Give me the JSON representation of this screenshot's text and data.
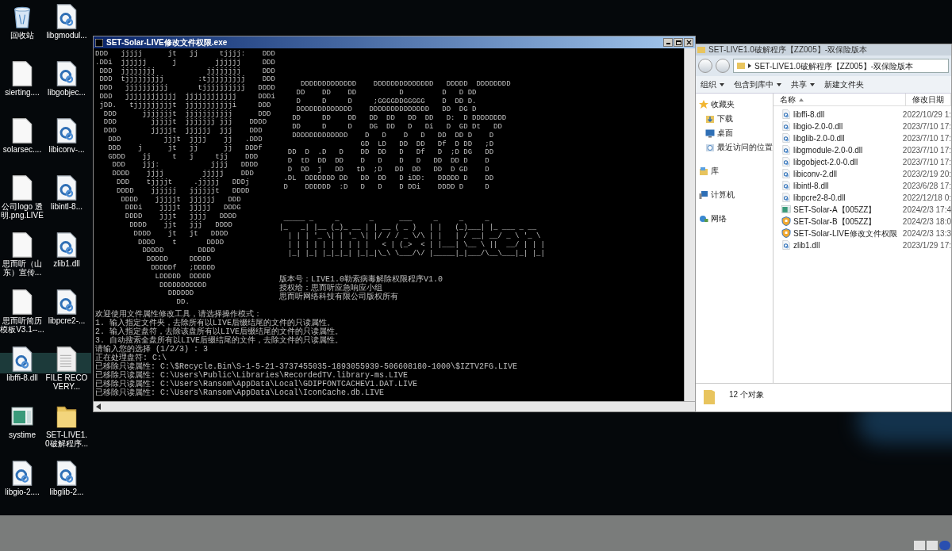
{
  "desktop_icons": [
    {
      "label": "回收站",
      "kind": "recycle"
    },
    {
      "label": "libgmodul...",
      "kind": "dll"
    },
    {
      "label": "sierting....",
      "kind": "blank"
    },
    {
      "label": "libgobjec...",
      "kind": "dll"
    },
    {
      "label": "solarsec....",
      "kind": "blank"
    },
    {
      "label": "libiconv-...",
      "kind": "dll"
    },
    {
      "label": "公司logo 透明.png.LIVE",
      "kind": "blank"
    },
    {
      "label": "libintl-8...",
      "kind": "dll"
    },
    {
      "label": "思而听（山东）宣传...",
      "kind": "blank"
    },
    {
      "label": "zlib1.dll",
      "kind": "dll"
    },
    {
      "label": "思而听简历模板V3.1--...",
      "kind": "blank"
    },
    {
      "label": "libpcre2-...",
      "kind": "dll"
    },
    {
      "label": "libffi-8.dll",
      "kind": "dll"
    },
    {
      "label": "FILE RECOVERY...",
      "kind": "text"
    },
    {
      "label": "systime",
      "kind": "app"
    },
    {
      "label": "SET-LIVE1.0破解程序...",
      "kind": "folder"
    },
    {
      "label": "libgio-2....",
      "kind": "dll"
    },
    {
      "label": "libglib-2...",
      "kind": "dll"
    }
  ],
  "console": {
    "title": "SET-Solar-LIVE修改文件权限.exe",
    "art_left": [
      "DDD   jjjjj      jt   jj     tjjjj:    DDD",
      ".DDi  jjjjjj      j         jjjjjj     DDD",
      " DDD  jjjjjjjj            jjjjjjjj     DDD",
      " DDD  tjjjjjjjjj        :tjjjjjjjjj    DDD",
      " DDD   jjjjjjjjjj       tjjjjjjjjjj   DDDD",
      " DDD   jjjjjjjjjjjj  jjjjjjjjjjjj     DDDi",
      " jDD.   tjjjjjjjjjt  jjjjjjjjjjji     DDD",
      "  DDD      jjjjjjjt  jjjjjjjjjjj      DDD",
      "  DDD        jjjjjt  jjjjjjj jjj    DDDD",
      "  DDD        jjjjjt  jjjjjj  jjj    DDD",
      "   DDD          jjjt  jjjj    jj   .DDD",
      "   DDD    j      jt   jj      jj   DDDf",
      "   GDDD    jj     t   j     tjj    DDD",
      "    DDD    jjj:            jjjj   DDDD",
      "    DDDD    jjjj         jjjjj    DDD",
      "     DDD    tjjjjt     .jjjjj   DDDj",
      "     DDDD    jjjjjj   jjjjjjt   DDDD",
      "      DDDD    jjjjjt  jjjjjj   DDD",
      "       DDDi    jjjjt  jjjjj   DDDG",
      "       DDDD    jjjt   jjjj   DDDD",
      "        DDDD    jjt   jjj   DDDD",
      "         DDDD    jt   jt   DDDD",
      "          DDDD    t       DDDD",
      "           DDDDD        DDDD",
      "            DDDDD     DDDDD",
      "             DDDDDf   ;DDDDD",
      "              LDDDDD  DDDDD",
      "               DDDDDDDDDDD",
      "                 DDDDDD",
      "                   DD."
    ],
    "art_right": [
      "     DDDDDDDDDDDDD    DDDDDDDDDDDDDD   DDDDD  DDDDDDDD",
      "    DD    DD    DD          D         D   D DD",
      "    D     D     D     ;GGGGDDGGGGG    D  DD D.",
      "    DDDDDDDDDDDDD    DDDDDDDDDDDDDD   DD  DG D",
      "   DD     DD    DD   DD  DD   DD  DD   D:  D DDDDDDDD",
      "   DD     D     D    DG  DD   D   Di   D  GD Dt   DD",
      "   DDDDDDDDDDDDD    D   D    D   D   DD  DD D    D",
      "                   GD  LD   DD  DD   Df  D DD   ;D",
      "  DD  D  .D   D    DD  DD   D   Df   D  ;D DG   DD",
      "  D  tD  DD  DD    D   D    D   D   DD  DD D    D",
      "  D  DD  j   DD   tD  ;D   DD  DD   DD  D GD    D",
      " .DL  DDDDDDD DD   DD  DD   D iDD:   DDDDD D    DD",
      " D    DDDDDD  :D   D   D    D DDi    DDDD D     D"
    ],
    "banner": [
      " _____ _     _       _      ___     _     _     _",
      "|_   _| |__ (_)_ __ | | __ ( _ )   | |   (_)___| |_ ___ _ __",
      "  | | | '_ \\| | '_ \\| |/ / / _ \\/\\ | |   | / __| __/ _ \\ '_ \\",
      "  | | | | | | | | | |   < | (_>  < | |___| \\__ \\ ||  __/ | | |",
      "  |_| |_| |_|_|_| |_|_|\\_\\ \\___/\\/ |_____|_|___/\\__\\___|_| |_|"
    ],
    "info": [
      "版本号：LIVE1.0勒索病毒解除权限程序V1.0",
      "授权给：思而听应急响应小组",
      "思而听网络科技有限公司版权所有"
    ],
    "output": [
      "欢迎使用文件属性修改工具，请选择操作模式：",
      "1. 输入指定文件夹，去除所有以LIVE后缀结尾的文件的只读属性。",
      "2. 输入指定盘符，去除该盘所有以LIVE后缀结尾的文件的只读属性。",
      "3. 自动搜索全盘所有以LIVE后缀结尾的文件，去除文件的只读属性。",
      "请输入您的选择 (1/2/3) : 3",
      "正在处理盘符: C:\\",
      "已移除只读属性: C:\\$Recycle.Bin\\S-1-5-21-3737455035-1893055939-506608180-1000\\$IZTV2FG.LIVE",
      "已移除只读属性: C:\\Users\\Public\\Libraries\\RecordedTV.library-ms.LIVE",
      "已移除只读属性: C:\\Users\\Ransom\\AppData\\Local\\GDIPFONTCACHEV1.DAT.LIVE",
      "已移除只读属性: C:\\Users\\Ransom\\AppData\\Local\\IconCache.db.LIVE"
    ]
  },
  "explorer": {
    "title": "SET-LIVE1.0破解程序【ZZ005】-双保险版本",
    "address": "SET-LIVE1.0破解程序【ZZ005】-双保险版本",
    "toolbar": [
      {
        "label": "组织",
        "dropdown": true
      },
      {
        "label": "包含到库中",
        "dropdown": true
      },
      {
        "label": "共享",
        "dropdown": true
      },
      {
        "label": "新建文件夹",
        "dropdown": false
      }
    ],
    "nav": [
      {
        "label": "收藏夹",
        "kind": "star",
        "children": [
          {
            "label": "下载",
            "kind": "download"
          },
          {
            "label": "桌面",
            "kind": "desktop"
          },
          {
            "label": "最近访问的位置",
            "kind": "recent"
          }
        ]
      },
      {
        "label": "库",
        "kind": "library"
      },
      {
        "label": "计算机",
        "kind": "computer"
      },
      {
        "label": "网络",
        "kind": "network"
      }
    ],
    "columns": [
      {
        "label": "名称",
        "sorted": true
      },
      {
        "label": "修改日期",
        "sorted": false
      }
    ],
    "files": [
      {
        "name": "libffi-8.dll",
        "date": "2022/10/29 1:",
        "kind": "dll"
      },
      {
        "name": "libgio-2.0-0.dll",
        "date": "2023/7/10 17:",
        "kind": "dll"
      },
      {
        "name": "libglib-2.0-0.dll",
        "date": "2023/7/10 17:",
        "kind": "dll"
      },
      {
        "name": "libgmodule-2.0-0.dll",
        "date": "2023/7/10 17:",
        "kind": "dll"
      },
      {
        "name": "libgobject-2.0-0.dll",
        "date": "2023/7/10 17:",
        "kind": "dll"
      },
      {
        "name": "libiconv-2.dll",
        "date": "2023/2/19 20:",
        "kind": "dll"
      },
      {
        "name": "libintl-8.dll",
        "date": "2023/6/28 17:",
        "kind": "dll"
      },
      {
        "name": "libpcre2-8-0.dll",
        "date": "2022/12/18 0:",
        "kind": "dll"
      },
      {
        "name": "SET-Solar-A【005ZZ】",
        "date": "2024/2/3 17:4",
        "kind": "app"
      },
      {
        "name": "SET-Solar-B【005ZZ】",
        "date": "2024/2/3 18:0",
        "kind": "shield"
      },
      {
        "name": "SET-Solar-LIVE修改文件权限",
        "date": "2024/2/3 13:3",
        "kind": "shield"
      },
      {
        "name": "zlib1.dll",
        "date": "2023/1/29 17:",
        "kind": "dll"
      }
    ],
    "status": "12 个对象"
  }
}
